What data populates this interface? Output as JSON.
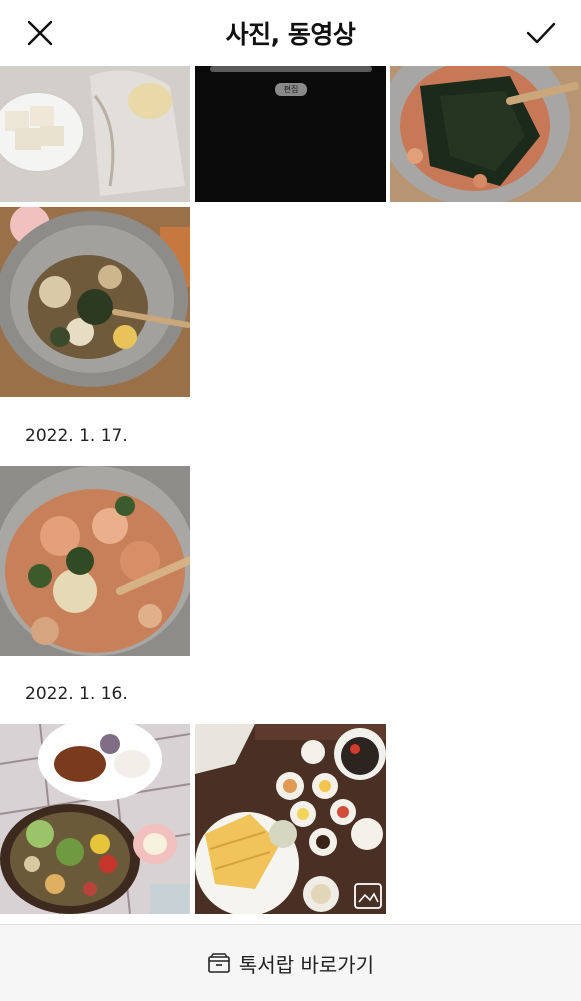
{
  "header": {
    "title": "사진, 동영상",
    "close_icon": "close-icon",
    "confirm_icon": "check-icon"
  },
  "gallery": {
    "sections": [
      {
        "date": ""
      },
      {
        "date": "2022. 1. 17."
      },
      {
        "date": "2022. 1. 16."
      }
    ],
    "edit_badge": "편집"
  },
  "footer": {
    "label": "톡서랍 바로가기",
    "icon": "drawer-icon"
  }
}
